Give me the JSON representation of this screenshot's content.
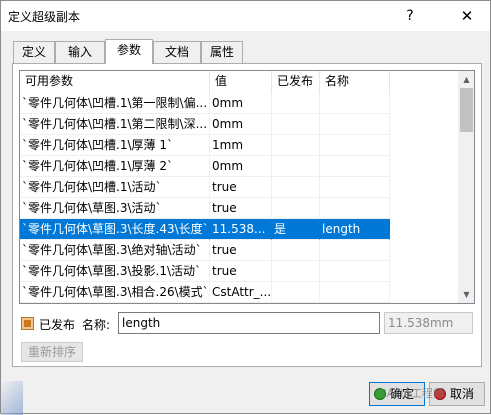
{
  "window": {
    "title": "定义超级副本",
    "help_symbol": "?",
    "close_symbol": "✕"
  },
  "tabs": [
    {
      "label": "定义",
      "active": false
    },
    {
      "label": "输入",
      "active": false
    },
    {
      "label": "参数",
      "active": true
    },
    {
      "label": "文档",
      "active": false
    },
    {
      "label": "属性",
      "active": false
    }
  ],
  "table": {
    "headers": [
      "可用参数",
      "值",
      "已发布",
      "名称"
    ],
    "rows": [
      {
        "param": "`零件几何体\\凹槽.1\\第一限制\\偏...",
        "value": "0mm",
        "published": "",
        "name": ""
      },
      {
        "param": "`零件几何体\\凹槽.1\\第二限制\\深...",
        "value": "0mm",
        "published": "",
        "name": ""
      },
      {
        "param": "`零件几何体\\凹槽.1\\厚薄 1`",
        "value": "1mm",
        "published": "",
        "name": ""
      },
      {
        "param": "`零件几何体\\凹槽.1\\厚薄 2`",
        "value": "0mm",
        "published": "",
        "name": ""
      },
      {
        "param": "`零件几何体\\凹槽.1\\活动`",
        "value": "true",
        "published": "",
        "name": ""
      },
      {
        "param": "`零件几何体\\草图.3\\活动`",
        "value": "true",
        "published": "",
        "name": ""
      },
      {
        "param": "`零件几何体\\草图.3\\长度.43\\长度`",
        "value": "11.538...",
        "published": "是",
        "name": "length",
        "selected": true
      },
      {
        "param": "`零件几何体\\草图.3\\绝对轴\\活动`",
        "value": "true",
        "published": "",
        "name": ""
      },
      {
        "param": "`零件几何体\\草图.3\\投影.1\\活动`",
        "value": "true",
        "published": "",
        "name": ""
      },
      {
        "param": "`零件几何体\\草图.3\\相合.26\\模式`",
        "value": "CstAttr_...",
        "published": "",
        "name": ""
      }
    ]
  },
  "publish": {
    "checkbox_label": "已发布",
    "name_label": "名称:",
    "name_value": "length",
    "value_readout": "11.538mm"
  },
  "reorder_button": "重新排序",
  "ok_button": "确定",
  "cancel_button": "取消",
  "watermark": "CATIA工程师"
}
